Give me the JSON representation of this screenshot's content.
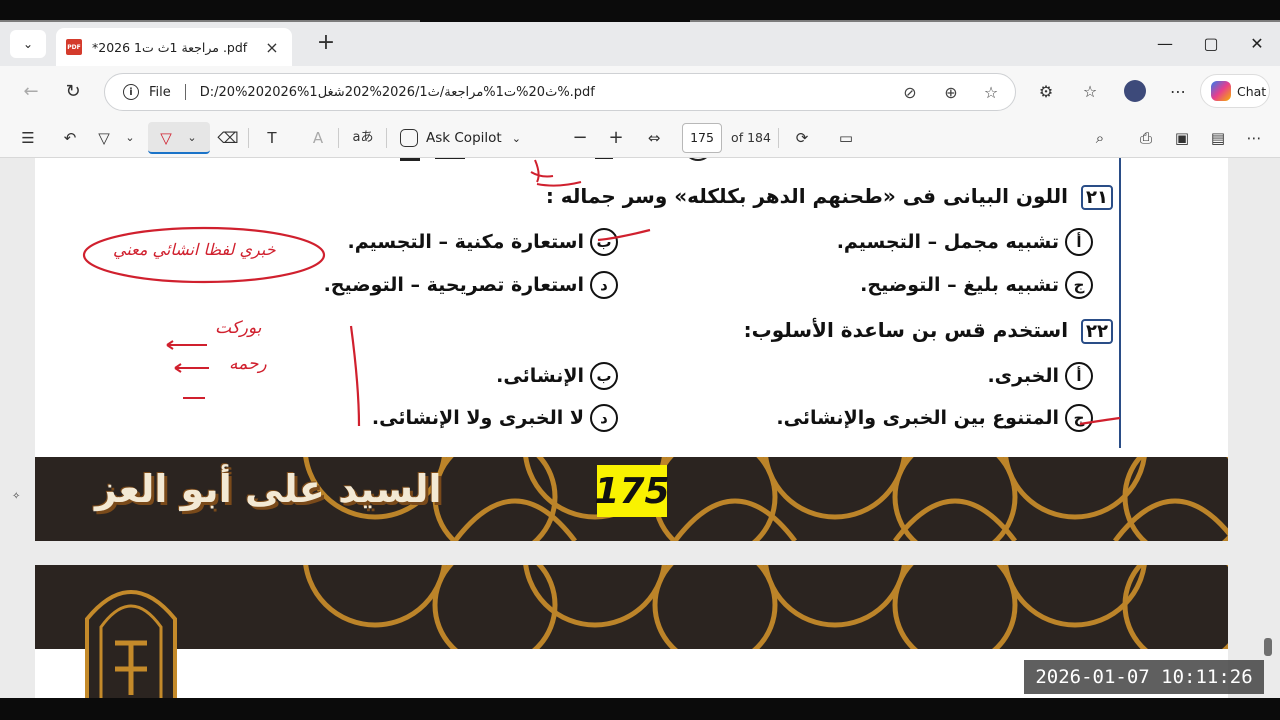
{
  "browser": {
    "tab": {
      "title": "*مراجعة 1ث ت1 2026 .pdf",
      "icon": "pdf-icon",
      "pdf_text": "PDF"
    },
    "new_tab": "+",
    "window": {
      "minimize": "—",
      "maximize": "▢",
      "close": "✕"
    },
    "address": {
      "scheme": "File",
      "url": "D:/20%202026%1ث20%ت1%مراجعة/ث2026/1%202شغل%.pdf"
    },
    "chat_label": "Chat"
  },
  "pdf_toolbar": {
    "ask_copilot": "Ask Copilot",
    "page_current": "175",
    "page_total": "of 184",
    "text_button": "T",
    "read_aloud": "aあ"
  },
  "document": {
    "q21": {
      "number": "٢١",
      "text": "اللون البيانى فى «طحنهم الدهر بكلكله» وسر جماله :"
    },
    "q21_options": [
      {
        "letter": "أ",
        "text": "تشبيه مجمل – التجسيم."
      },
      {
        "letter": "ب",
        "text": "استعارة مكنية – التجسيم."
      },
      {
        "letter": "ج",
        "text": "تشبيه بليغ – التوضيح."
      },
      {
        "letter": "د",
        "text": "استعارة تصريحية – التوضيح."
      }
    ],
    "q22": {
      "number": "٢٢",
      "text": "استخدم قس بن ساعدة الأسلوب:"
    },
    "q22_options": [
      {
        "letter": "أ",
        "text": "الخبرى."
      },
      {
        "letter": "ب",
        "text": "الإنشائى."
      },
      {
        "letter": "ج",
        "text": "المتنوع بين الخبرى والإنشائى."
      },
      {
        "letter": "د",
        "text": "لا الخبرى ولا الإنشائى."
      }
    ],
    "handwriting": {
      "bubble": "خبري لفظا انشائي معني",
      "list_1": "بوركت",
      "list_2": "رحمه"
    },
    "page_number": "175",
    "author": "السيد على أبو العز"
  },
  "overlay": {
    "timestamp": "2026-01-07  10:11:26"
  },
  "colors": {
    "ink_red": "#d0202e",
    "accent_blue": "#2a4d87",
    "badge_yellow": "#f9f200",
    "banner_dark": "#2b2420"
  }
}
